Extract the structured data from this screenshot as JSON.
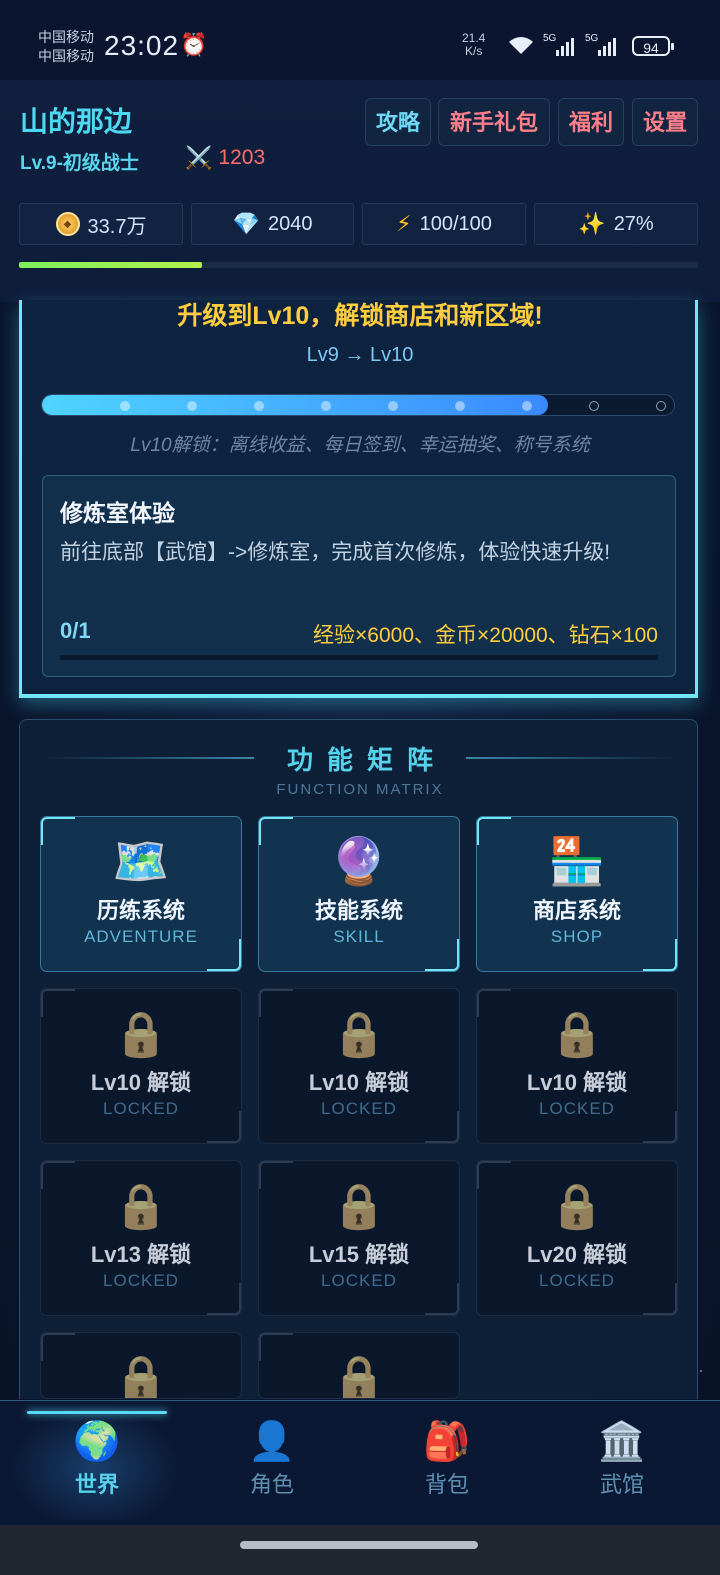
{
  "status_bar": {
    "carrier_1": "中国移动",
    "carrier_2": "中国移动",
    "time": "23:02",
    "alarm_icon": "alarm-icon",
    "net_speed_value": "21.4",
    "net_speed_unit": "K/s",
    "signal_1": "5G",
    "signal_2": "5G",
    "battery": "94"
  },
  "header": {
    "player_name": "山的那边",
    "level_title": "Lv.9-初级战士",
    "combat_power": "1203",
    "buttons": [
      {
        "label": "攻略",
        "color": "#6fd8f2"
      },
      {
        "label": "新手礼包",
        "color": "#ff7f8a"
      },
      {
        "label": "福利",
        "color": "#ff7f8a"
      },
      {
        "label": "设置",
        "color": "#ff7f8a"
      }
    ],
    "resources": {
      "gold": "33.7万",
      "diamond": "2040",
      "energy": "100/100",
      "bonus": "27%"
    },
    "exp_progress": 0.27
  },
  "quest": {
    "headline": "升级到Lv10，解锁商店和新区域!",
    "level_change": "Lv9 → Lv10",
    "progress_fraction": 0.8,
    "milestones": 9,
    "milestones_reached": 7,
    "unlock_note": "Lv10解锁：离线收益、每日签到、幸运抽奖、称号系统",
    "task": {
      "title": "修炼室体验",
      "description": "前往底部【武馆】->修炼室，完成首次修炼，体验快速升级!",
      "progress": "0/1",
      "progress_fraction": 0,
      "reward": "经验×6000、金币×20000、钻石×100"
    }
  },
  "matrix": {
    "title": "功能矩阵",
    "subtitle": "FUNCTION MATRIX",
    "cards": [
      {
        "icon": "🗺️",
        "icon_name": "map-icon",
        "label": "历练系统",
        "en": "ADVENTURE",
        "locked": false
      },
      {
        "icon": "🔮",
        "icon_name": "crystal-ball-icon",
        "label": "技能系统",
        "en": "SKILL",
        "locked": false
      },
      {
        "icon": "🏪",
        "icon_name": "store-icon",
        "label": "商店系统",
        "en": "SHOP",
        "locked": false
      },
      {
        "icon": "🔒",
        "icon_name": "lock-icon",
        "label": "Lv10 解锁",
        "en": "LOCKED",
        "locked": true
      },
      {
        "icon": "🔒",
        "icon_name": "lock-icon",
        "label": "Lv10 解锁",
        "en": "LOCKED",
        "locked": true
      },
      {
        "icon": "🔒",
        "icon_name": "lock-icon",
        "label": "Lv10 解锁",
        "en": "LOCKED",
        "locked": true
      },
      {
        "icon": "🔒",
        "icon_name": "lock-icon",
        "label": "Lv13 解锁",
        "en": "LOCKED",
        "locked": true
      },
      {
        "icon": "🔒",
        "icon_name": "lock-icon",
        "label": "Lv15 解锁",
        "en": "LOCKED",
        "locked": true
      },
      {
        "icon": "🔒",
        "icon_name": "lock-icon",
        "label": "Lv20 解锁",
        "en": "LOCKED",
        "locked": true
      },
      {
        "icon": "🔒",
        "icon_name": "lock-icon",
        "label": "",
        "en": "",
        "locked": true
      },
      {
        "icon": "🔒",
        "icon_name": "lock-icon",
        "label": "",
        "en": "",
        "locked": true
      }
    ]
  },
  "nav": {
    "items": [
      {
        "icon": "🌍",
        "icon_name": "globe-icon",
        "label": "世界",
        "active": true
      },
      {
        "icon": "👤",
        "icon_name": "user-icon",
        "label": "角色",
        "active": false
      },
      {
        "icon": "🎒",
        "icon_name": "backpack-icon",
        "label": "背包",
        "active": false
      },
      {
        "icon": "🏛️",
        "icon_name": "dojo-icon",
        "label": "武馆",
        "active": false
      }
    ]
  },
  "colors": {
    "accent_cyan": "#56d3ec",
    "gold": "#ffcd3e",
    "red": "#ff6d6d",
    "background": "#0b1833"
  }
}
